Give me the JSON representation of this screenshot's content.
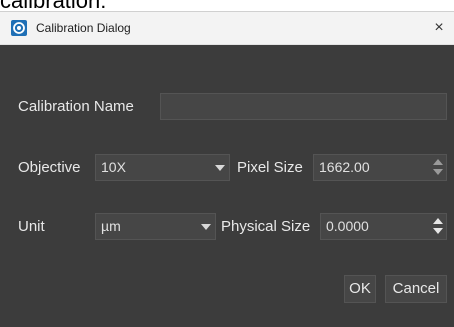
{
  "page_header_fragment": "calibration:",
  "dialog": {
    "title": "Calibration Dialog",
    "close_glyph": "×",
    "icons": {
      "app": "app-eye-icon",
      "close": "close-icon",
      "combo_arrow": "chevron-down-icon",
      "spin": "spin-arrows-icon"
    }
  },
  "form": {
    "calibration_name": {
      "label": "Calibration Name",
      "value": ""
    },
    "objective": {
      "label": "Objective",
      "value": "10X"
    },
    "pixel_size": {
      "label": "Pixel Size",
      "value": "1662.00"
    },
    "unit": {
      "label": "Unit",
      "value": "µm"
    },
    "physical_size": {
      "label": "Physical Size",
      "value": "0.0000"
    }
  },
  "buttons": {
    "ok": "OK",
    "cancel": "Cancel"
  },
  "colors": {
    "dialog_bg": "#3c3c3c",
    "field_bg": "#464646",
    "titlebar_bg": "#f3f3f3",
    "icon_blue": "#1f6fb5"
  }
}
